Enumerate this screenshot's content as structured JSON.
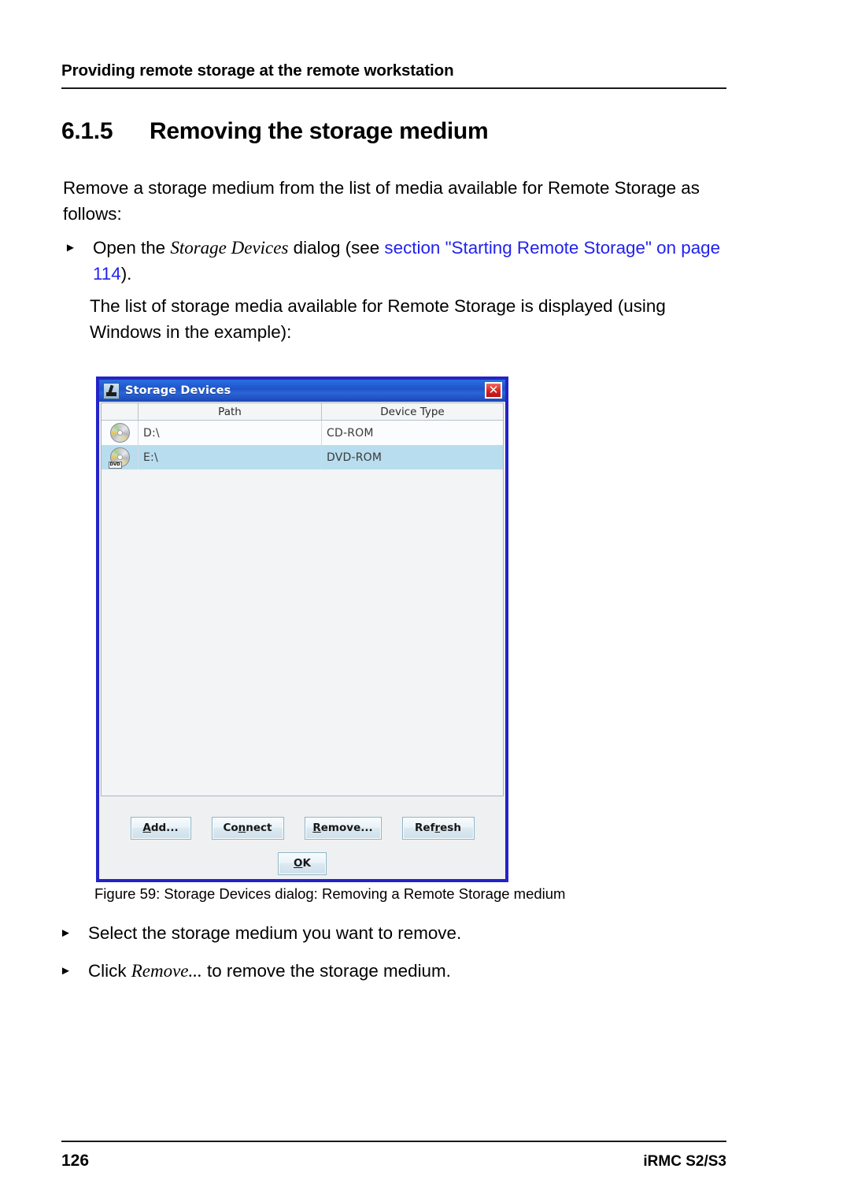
{
  "running_header": {
    "text": "Providing remote storage at the remote workstation"
  },
  "section": {
    "number": "6.1.5",
    "title": "Removing the storage medium"
  },
  "body": {
    "intro": "Remove a storage medium from the list of media available for Remote Storage as follows:",
    "bullet_marker": "►",
    "open_bullet": {
      "part1": "Open the ",
      "dialog_name": "Storage Devices",
      "part2": " dialog (see ",
      "link": "section \"Starting Remote Storage\" on page 114",
      "part3": ")."
    },
    "after_open": "The list of storage media available for Remote Storage is displayed (using Windows in the example):",
    "select_bullet": "Select the storage medium you want to remove.",
    "click_bullet": {
      "part1": "Click ",
      "emphasis": "Remove...",
      "part2": " to remove the storage medium."
    }
  },
  "figure": {
    "caption": "Figure 59:  Storage Devices dialog: Removing a Remote Storage medium"
  },
  "dialog": {
    "title": "Storage Devices",
    "title_icon": "application-window-icon",
    "close_label": "✕",
    "columns": [
      "",
      "Path",
      "Device Type"
    ],
    "rows": [
      {
        "icon": "cd-rom-disc-icon",
        "icon_tag": "",
        "path": "D:\\",
        "device_type": "CD-ROM",
        "selected": false
      },
      {
        "icon": "dvd-rom-disc-icon",
        "icon_tag": "DVD",
        "path": "E:\\",
        "device_type": "DVD-ROM",
        "selected": true
      }
    ],
    "buttons": {
      "add": {
        "before": "",
        "mnemonic": "A",
        "after": "dd..."
      },
      "connect": {
        "before": "Co",
        "mnemonic": "n",
        "after": "nect"
      },
      "remove": {
        "before": "",
        "mnemonic": "R",
        "after": "emove..."
      },
      "refresh": {
        "before": "Ref",
        "mnemonic": "r",
        "after": "esh"
      },
      "ok": {
        "before": "",
        "mnemonic": "O",
        "after": "K"
      }
    },
    "colors": {
      "title_bar": "#1f54c8",
      "border": "#2323c8",
      "close_button": "#d62222",
      "selected_row": "#b8ddee"
    }
  },
  "footer": {
    "page_number": "126",
    "product": "iRMC S2/S3"
  },
  "theme": {
    "link_color": "#2222ee"
  }
}
